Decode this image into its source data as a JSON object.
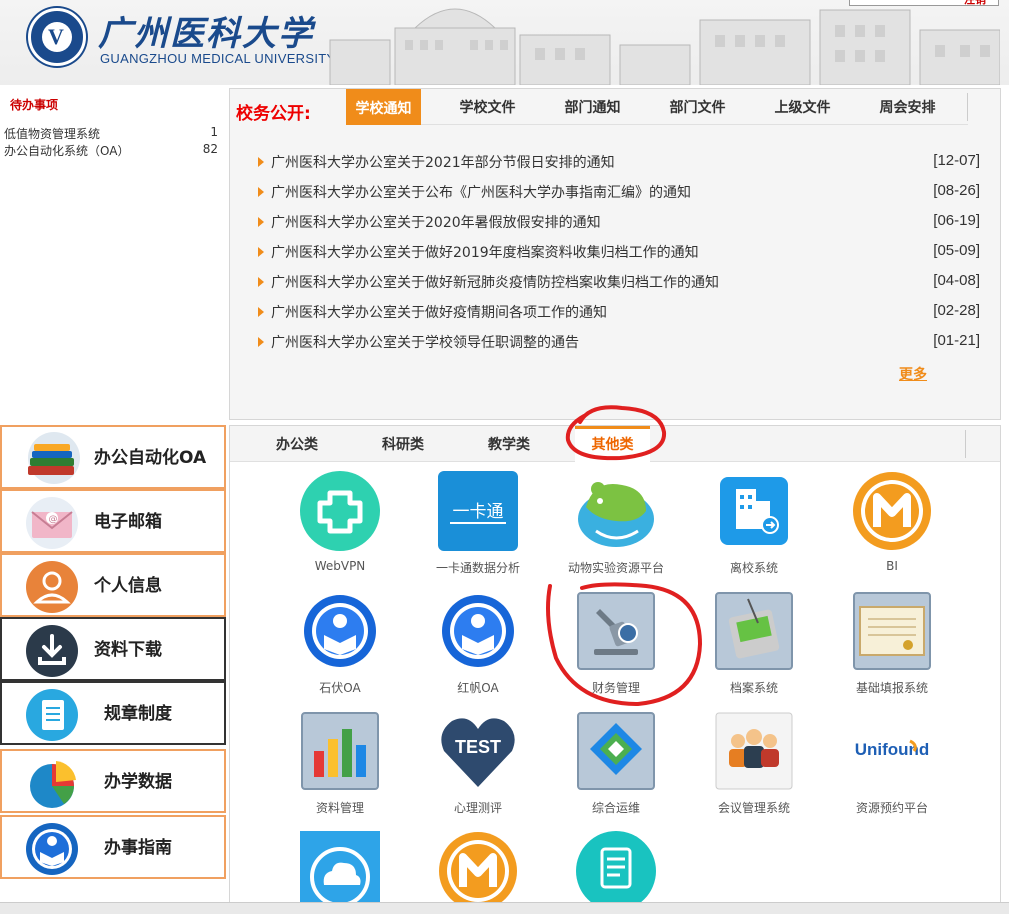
{
  "header": {
    "logo_cn": "广州医科大学",
    "logo_en": "GUANGZHOU MEDICAL UNIVERSITY",
    "top_button_label": "注销"
  },
  "todo": {
    "title": "待办事项",
    "items": [
      {
        "label": "低值物资管理系统",
        "count": "1"
      },
      {
        "label": "办公自动化系统（OA）",
        "count": "82"
      }
    ]
  },
  "news": {
    "section_title": "校务公开:",
    "tabs": [
      "学校通知",
      "学校文件",
      "部门通知",
      "部门文件",
      "上级文件",
      "周会安排"
    ],
    "active_tab": 0,
    "items": [
      {
        "text": "广州医科大学办公室关于2021年部分节假日安排的通知",
        "date": "[12-07]"
      },
      {
        "text": "广州医科大学办公室关于公布《广州医科大学办事指南汇编》的通知",
        "date": "[08-26]"
      },
      {
        "text": "广州医科大学办公室关于2020年暑假放假安排的通知",
        "date": "[06-19]"
      },
      {
        "text": "广州医科大学办公室关于做好2019年度档案资料收集归档工作的通知",
        "date": "[05-09]"
      },
      {
        "text": "广州医科大学办公室关于做好新冠肺炎疫情防控档案收集归档工作的通知",
        "date": "[04-08]"
      },
      {
        "text": "广州医科大学办公室关于做好疫情期间各项工作的通知",
        "date": "[02-28]"
      },
      {
        "text": "广州医科大学办公室关于学校领导任职调整的通告",
        "date": "[01-21]"
      }
    ],
    "more_label": "更多"
  },
  "sidebar": {
    "buttons": [
      {
        "label": "办公自动化OA",
        "icon": "books-icon"
      },
      {
        "label": "电子邮箱",
        "icon": "envelope-icon"
      },
      {
        "label": "个人信息",
        "icon": "person-icon"
      },
      {
        "label": "资料下载",
        "icon": "download-icon"
      },
      {
        "label": "规章制度",
        "icon": "notebook-icon"
      },
      {
        "label": "办学数据",
        "icon": "pie-chart-icon"
      },
      {
        "label": "办事指南",
        "icon": "guide-book-icon"
      }
    ]
  },
  "apps": {
    "tabs": [
      "办公类",
      "科研类",
      "教学类",
      "其他类"
    ],
    "active_tab": 3,
    "items": [
      {
        "name": "WebVPN",
        "icon": "webvpn-icon"
      },
      {
        "name": "一卡通数据分析",
        "icon": "card-icon",
        "tile_text": "一卡通"
      },
      {
        "name": "动物实验资源平台",
        "icon": "mouse-icon"
      },
      {
        "name": "离校系统",
        "icon": "building-exit-icon"
      },
      {
        "name": "BI",
        "icon": "bi-logo-icon"
      },
      {
        "name": "石伏OA",
        "icon": "oa-reader-icon"
      },
      {
        "name": "红帆OA",
        "icon": "oa-reader-icon"
      },
      {
        "name": "财务管理",
        "icon": "microscope-icon"
      },
      {
        "name": "档案系统",
        "icon": "pda-icon"
      },
      {
        "name": "基础填报系统",
        "icon": "certificate-icon"
      },
      {
        "name": "资料管理",
        "icon": "bar-chart-icon"
      },
      {
        "name": "心理测评",
        "icon": "heart-icon",
        "tile_text": "TEST"
      },
      {
        "name": "综合运维",
        "icon": "maintenance-icon"
      },
      {
        "name": "会议管理系统",
        "icon": "meeting-icon"
      },
      {
        "name": "资源预约平台",
        "icon": "unifound-logo-icon",
        "tile_text": "Unifound"
      },
      {
        "name": "",
        "icon": "cloud-icon"
      },
      {
        "name": "",
        "icon": "m-logo-icon"
      },
      {
        "name": "",
        "icon": "document-icon"
      }
    ]
  },
  "colors": {
    "accent": "#f08c1a",
    "title_red": "#e00000",
    "brand_blue": "#1a4a8c",
    "annotation_red": "#e02020"
  }
}
